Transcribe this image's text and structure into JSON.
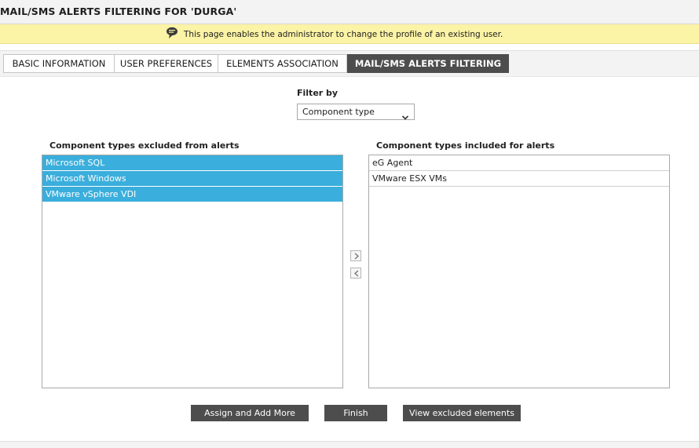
{
  "page": {
    "title": "MAIL/SMS ALERTS FILTERING FOR 'DURGA'",
    "info_message": "This page enables the administrator to change the profile of an existing user."
  },
  "tabs": [
    {
      "label": "BASIC INFORMATION",
      "active": false
    },
    {
      "label": "USER PREFERENCES",
      "active": false
    },
    {
      "label": "ELEMENTS ASSOCIATION",
      "active": false
    },
    {
      "label": "MAIL/SMS ALERTS FILTERING",
      "active": true
    }
  ],
  "filter": {
    "label": "Filter by",
    "selected": "Component type"
  },
  "excluded": {
    "heading": "Component types excluded from alerts",
    "items": [
      "Microsoft SQL",
      "Microsoft Windows",
      "VMware vSphere VDI"
    ]
  },
  "included": {
    "heading": "Component types included for alerts",
    "items": [
      "eG Agent",
      "VMware ESX VMs"
    ]
  },
  "buttons": {
    "assign": "Assign and Add More",
    "finish": "Finish",
    "view_excluded": "View excluded elements"
  },
  "colors": {
    "selected_item": "#3aaedc",
    "active_tab": "#4d4d4d",
    "info_bar": "#fbf3a5",
    "button": "#4d4d4d"
  },
  "icons": {
    "info": "speech-bubble-icon",
    "dropdown": "chevron-down-icon",
    "move_right": "chevron-right-icon",
    "move_left": "chevron-left-icon"
  }
}
